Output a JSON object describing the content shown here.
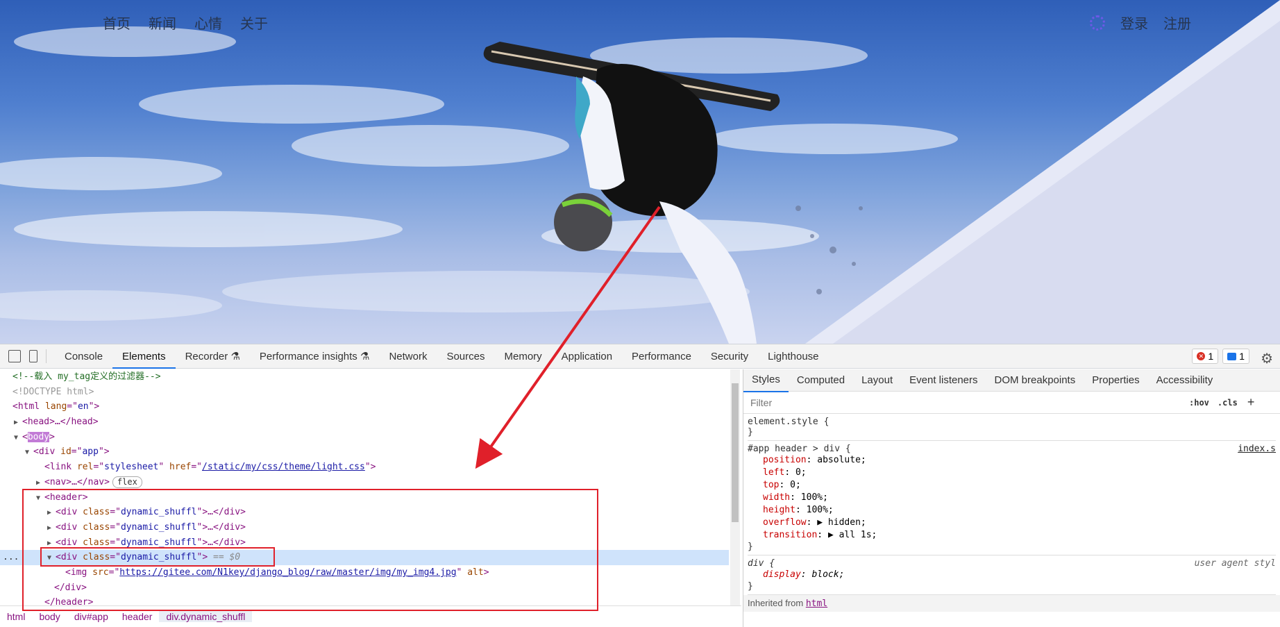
{
  "page": {
    "nav_left": [
      "首页",
      "新闻",
      "心情",
      "关于"
    ],
    "nav_right": [
      "登录",
      "注册"
    ]
  },
  "devtools": {
    "tabs": [
      "Console",
      "Elements",
      "Recorder",
      "Performance insights",
      "Network",
      "Sources",
      "Memory",
      "Application",
      "Performance",
      "Security",
      "Lighthouse"
    ],
    "active_tab": "Elements",
    "error_count": "1",
    "message_count": "1",
    "dom": {
      "comment": "<!--载入 my_tag定义的过滤器-->",
      "doctype": "<!DOCTYPE html>",
      "html_lang": "en",
      "link_rel": "stylesheet",
      "link_href": "/static/my/css/theme/light.css",
      "nav_badge": "flex",
      "div_class": "dynamic_shuffl",
      "selected_marker": "== $0",
      "img_src": "https://gitee.com/N1key/django_blog/raw/master/img/my_img4.jpg",
      "ellipsis": "..."
    },
    "breadcrumbs": [
      "html",
      "body",
      "div#app",
      "header",
      "div.dynamic_shuffl"
    ],
    "side_tabs": [
      "Styles",
      "Computed",
      "Layout",
      "Event listeners",
      "DOM breakpoints",
      "Properties",
      "Accessibility"
    ],
    "filter_placeholder": "Filter",
    "filter_opts": [
      ":hov",
      ".cls",
      "+"
    ],
    "rules": [
      {
        "selector": "element.style {",
        "props": [],
        "source": "",
        "close": "}"
      },
      {
        "selector": "#app header > div {",
        "source": "index.s",
        "close": "}",
        "props": [
          {
            "name": "position",
            "value": "absolute;"
          },
          {
            "name": "left",
            "value": "0;"
          },
          {
            "name": "top",
            "value": "0;"
          },
          {
            "name": "width",
            "value": "100%;"
          },
          {
            "name": "height",
            "value": "100%;"
          },
          {
            "name": "overflow",
            "value": "▶ hidden;"
          },
          {
            "name": "transition",
            "value": "▶ all 1s;"
          }
        ]
      },
      {
        "selector": "div {",
        "ua": "user agent styl",
        "close": "}",
        "props": [
          {
            "name": "display",
            "value": "block;"
          }
        ]
      }
    ],
    "inherited_label": "Inherited from",
    "inherited_tag": "html"
  },
  "colors": {
    "annotation": "#e0202a",
    "accent": "#1a73e8"
  }
}
